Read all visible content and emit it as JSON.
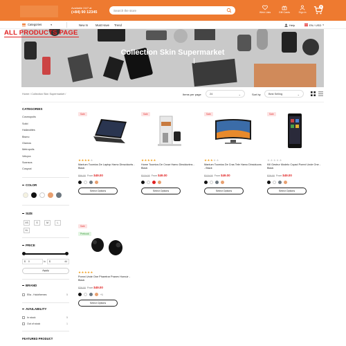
{
  "header": {
    "support_line1": "Available 24/7 at",
    "support_line2": "(+84) 90 12345",
    "search_placeholder": "Search the store",
    "wishlist_label": "Wish Lists",
    "giftcards_label": "Gift Cards",
    "signin_label": "Sign in",
    "cart_count": "0"
  },
  "nav": {
    "categories_label": "Categories",
    "links": [
      "New In",
      "Must Have",
      "Trend"
    ],
    "help_label": "Help",
    "locale_label": "EN / USD"
  },
  "annotation_label": "ALL PRODUCTS PAGE",
  "banner": {
    "title": "Collection Skin Supermarket"
  },
  "breadcrumb": "Home / Collection Skin Supermarket /",
  "toolbar": {
    "items_label": "Items per page",
    "items_value": "24",
    "sort_label": "Sort by",
    "sort_value": "Best Selling"
  },
  "sidebar": {
    "categories_heading": "CATEGORIES",
    "categories": [
      "Cosmopolis",
      "Solid",
      "Hallandites",
      "Bismo",
      "Glamos",
      "Metropolis",
      "Velcyra",
      "Scansos",
      "Cosycal"
    ],
    "color_heading": "COLOR",
    "colors": [
      "#f5f2e0",
      "#111111",
      "#ffffff",
      "#e8a070",
      "#6d7880"
    ],
    "size_heading": "SIZE",
    "sizes": [
      "XS",
      "S",
      "M",
      "L",
      "XL"
    ],
    "price_heading": "PRICE",
    "price_currency_min": "$",
    "price_min": "0",
    "price_to": "to",
    "price_currency_max": "$",
    "price_max": "44",
    "apply_label": "Apply",
    "brand_heading": "BRAND",
    "brands": [
      {
        "label": "Ella - Halothemes",
        "count": "5"
      }
    ],
    "availability_heading": "AVAILABILITY",
    "availability": [
      {
        "label": "In stock",
        "count": "5"
      },
      {
        "label": "Out of stock",
        "count": "1"
      }
    ],
    "featured_heading": "FEATURED PRODUCT"
  },
  "products": [
    {
      "badge": "Sale",
      "prebook": "",
      "rating": 4,
      "stars": "★★★★★",
      "name": "Mantum Toomios De Laptop Hamo Dinscidunts - Black",
      "old_price": "$56.00",
      "from": "From",
      "new_price": "$49.00",
      "dots": [
        "#111111",
        "#ffffff",
        "#6d7880",
        "#e8a070"
      ],
      "more": ""
    },
    {
      "badge": "Sale",
      "prebook": "",
      "rating": 5,
      "stars": "★★★★★",
      "name": "Home Toomios De Cruse Hamo Dinsiduntns - Black",
      "old_price": "$119.00",
      "from": "From",
      "new_price": "$49.00",
      "dots": [
        "#111111",
        "#ffffff",
        "#e02020",
        "#e8a070"
      ],
      "more": ""
    },
    {
      "badge": "Sale",
      "prebook": "",
      "rating": 3,
      "stars": "★★★★★",
      "name": "Mantum Toomios De Cras Tele Hamo Dinsiduuns - Black",
      "old_price": "$119.00",
      "from": "From",
      "new_price": "$49.00",
      "dots": [
        "#111111",
        "#ffffff",
        "#6d7880",
        "#e8a070"
      ],
      "more": ""
    },
    {
      "badge": "Sale",
      "prebook": "",
      "rating": 0,
      "stars": "★★★★★",
      "name": "Kill Gestrur Modelo Copad Pomni Unde One - Black",
      "old_price": "$29.00",
      "from": "From",
      "new_price": "$49.00",
      "dots": [
        "#111111",
        "#ffffff",
        "#6d7880",
        "#e8a070"
      ],
      "more": ""
    },
    {
      "badge": "Sale",
      "prebook": "Prebook",
      "rating": 5,
      "stars": "★★★★★",
      "name": "Pomni Unde One Pharetrar Pranev Hornuir - Black",
      "old_price": "$39.00",
      "from": "From",
      "new_price": "$49.00",
      "dots": [
        "#111111",
        "#ffffff",
        "#6d7880",
        "#e8a070"
      ],
      "more": "+1"
    }
  ],
  "select_options_label": "Select Options",
  "colors": {
    "accent": "#ee7a30",
    "sale": "#e02020",
    "star": "#f0a020"
  }
}
